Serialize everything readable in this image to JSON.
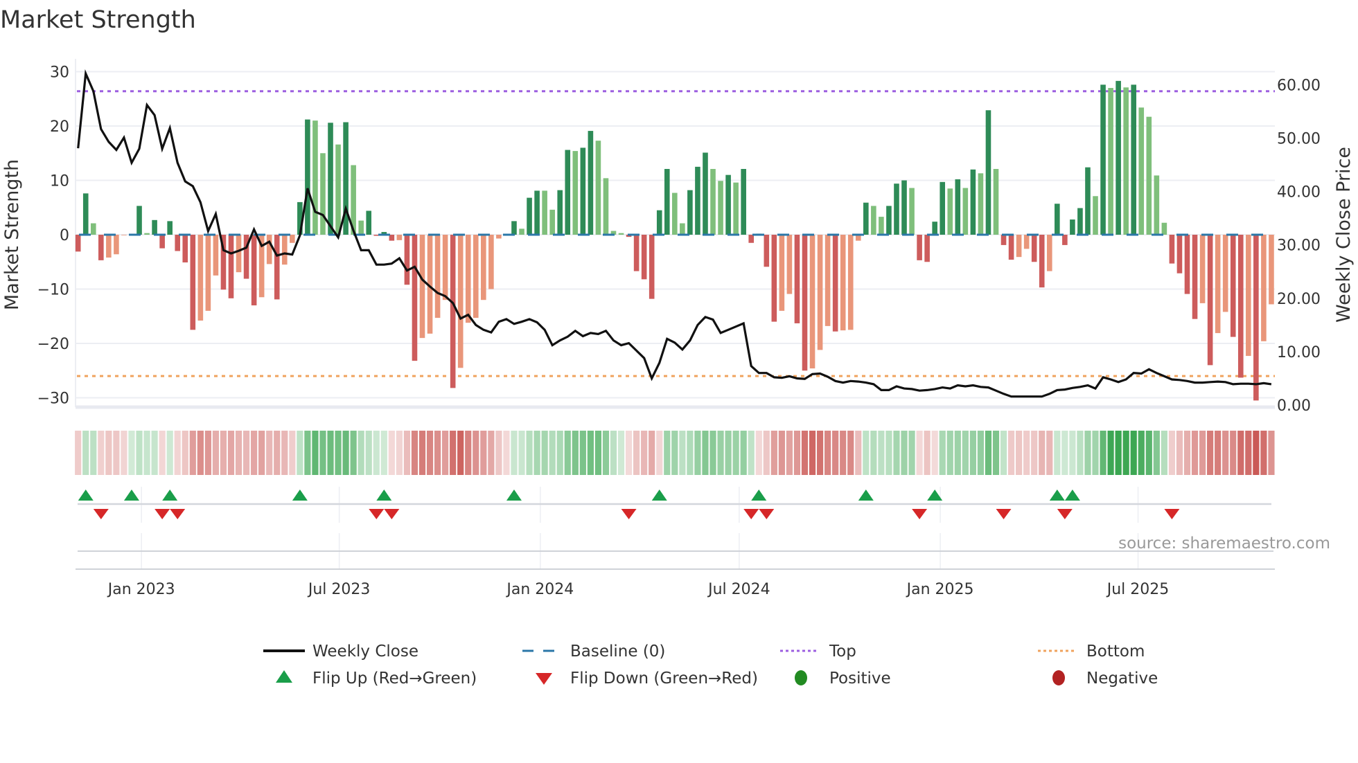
{
  "chart_data": {
    "type": "bar",
    "title": "Market Strength",
    "ylabel": "Market Strength",
    "y2label": "Weekly Close Price",
    "source": "source: sharemaestro.com",
    "start_date": "2022-11-04",
    "interval_days": 7,
    "ylim": [
      -31.5,
      32
    ],
    "y2lim": [
      -0.5,
      62.8
    ],
    "yticks": [
      {
        "v": 30,
        "label": "30"
      },
      {
        "v": 20,
        "label": "20"
      },
      {
        "v": 10,
        "label": "10"
      },
      {
        "v": 0,
        "label": "0"
      },
      {
        "v": -10,
        "label": "−10"
      },
      {
        "v": -20,
        "label": "−20"
      },
      {
        "v": -30,
        "label": "−30"
      }
    ],
    "y2ticks": [
      {
        "v": 60,
        "label": "60.00"
      },
      {
        "v": 50,
        "label": "50.00"
      },
      {
        "v": 40,
        "label": "40.00"
      },
      {
        "v": 30,
        "label": "30.00"
      },
      {
        "v": 20,
        "label": "20.00"
      },
      {
        "v": 10,
        "label": "10.00"
      },
      {
        "v": 0,
        "label": "0.00"
      }
    ],
    "xticks": [
      {
        "date": "2023-01-01",
        "label": "Jan 2023"
      },
      {
        "date": "2023-07-01",
        "label": "Jul 2023"
      },
      {
        "date": "2024-01-01",
        "label": "Jan 2024"
      },
      {
        "date": "2024-07-01",
        "label": "Jul 2024"
      },
      {
        "date": "2025-01-01",
        "label": "Jan 2025"
      },
      {
        "date": "2025-07-01",
        "label": "Jul 2025"
      }
    ],
    "top_level": 26.4,
    "bottom_level": -26.0,
    "strength": [
      -3.1,
      7.6,
      2.1,
      -4.7,
      -4.2,
      -3.6,
      -0.1,
      0.1,
      5.3,
      0.3,
      2.7,
      -2.5,
      2.5,
      -3.0,
      -5.1,
      -17.5,
      -15.8,
      -14.0,
      -7.5,
      -10.1,
      -11.7,
      -6.9,
      -8.1,
      -13.0,
      -11.5,
      -5.4,
      -11.9,
      -5.5,
      -1.5,
      6.0,
      21.2,
      21.0,
      15.0,
      20.6,
      16.6,
      20.7,
      12.8,
      2.6,
      4.4,
      -0.2,
      0.5,
      -1.1,
      -1.0,
      -9.2,
      -23.2,
      -19.0,
      -18.2,
      -15.3,
      -12.0,
      -28.2,
      -24.5,
      -16.2,
      -15.3,
      -12.0,
      -10.0,
      -0.7,
      -0.05,
      2.5,
      1.1,
      6.8,
      8.1,
      8.1,
      4.6,
      8.2,
      15.6,
      15.4,
      16.0,
      19.1,
      17.3,
      10.4,
      0.7,
      0.3,
      -0.4,
      -6.7,
      -8.2,
      -11.8,
      4.5,
      12.1,
      7.7,
      2.1,
      8.2,
      12.5,
      15.1,
      12.1,
      9.9,
      11.0,
      9.6,
      12.1,
      -1.5,
      0.2,
      -5.9,
      -16.0,
      -14.0,
      -10.9,
      -16.3,
      -25.0,
      -24.6,
      -21.2,
      -16.8,
      -17.8,
      -17.6,
      -17.5,
      -1.1,
      5.9,
      5.3,
      3.3,
      5.3,
      9.4,
      10.0,
      8.6,
      -4.7,
      -5.0,
      2.4,
      9.7,
      8.5,
      10.2,
      8.6,
      12.0,
      11.3,
      22.9,
      12.1,
      -1.9,
      -4.6,
      -4.1,
      -2.6,
      -5.0,
      -9.7,
      -6.7,
      5.7,
      -1.9,
      2.8,
      4.9,
      12.4,
      7.1,
      27.6,
      27.0,
      28.3,
      27.1,
      27.6,
      23.4,
      21.7,
      10.9,
      2.2,
      -5.3,
      -7.1,
      -10.9,
      -15.5,
      -12.6,
      -24.0,
      -18.1,
      -14.2,
      -18.8,
      -26.3,
      -22.3,
      -30.5,
      -19.6,
      -12.8
    ],
    "weekly_close": [
      48.1,
      62.1,
      58.8,
      51.7,
      49.3,
      47.8,
      50.1,
      45.4,
      48.0,
      56.2,
      54.3,
      48.0,
      51.9,
      45.4,
      41.9,
      41.0,
      38.0,
      32.6,
      35.8,
      29.0,
      28.4,
      28.9,
      29.5,
      32.9,
      29.8,
      30.6,
      28.0,
      28.4,
      28.2,
      31.8,
      40.6,
      36.2,
      35.6,
      33.5,
      31.4,
      36.8,
      32.7,
      29.0,
      29.0,
      26.3,
      26.3,
      26.5,
      27.5,
      25.2,
      25.9,
      23.5,
      22.2,
      21.0,
      20.4,
      19.1,
      16.2,
      16.9,
      15.0,
      14.1,
      13.6,
      15.6,
      16.1,
      15.2,
      15.6,
      16.1,
      15.5,
      14.1,
      11.2,
      12.1,
      12.8,
      13.9,
      12.9,
      13.5,
      13.3,
      13.9,
      12.1,
      11.2,
      11.6,
      10.2,
      8.8,
      5.0,
      7.9,
      12.4,
      11.7,
      10.4,
      12.1,
      15.0,
      16.5,
      16.0,
      13.5,
      14.1,
      14.7,
      15.3,
      7.3,
      6.0,
      6.0,
      5.2,
      5.1,
      5.4,
      5.0,
      4.9,
      5.8,
      5.9,
      5.3,
      4.5,
      4.2,
      4.5,
      4.4,
      4.2,
      3.9,
      2.8,
      2.8,
      3.5,
      3.1,
      3.0,
      2.7,
      2.8,
      3.0,
      3.3,
      3.1,
      3.7,
      3.5,
      3.7,
      3.4,
      3.3,
      2.7,
      2.1,
      1.6,
      1.6,
      1.6,
      1.6,
      1.6,
      2.1,
      2.8,
      2.9,
      3.2,
      3.4,
      3.7,
      3.1,
      5.2,
      4.8,
      4.3,
      4.8,
      6.0,
      5.9,
      6.7,
      6.0,
      5.4,
      4.8,
      4.7,
      4.5,
      4.2,
      4.2,
      4.3,
      4.4,
      4.3,
      3.9,
      4.0,
      4.0,
      3.9,
      4.1,
      3.9
    ],
    "flip_up_weeks": [
      1,
      7,
      12,
      29,
      40,
      57,
      76,
      89,
      103,
      112,
      128,
      130
    ],
    "flip_down_weeks": [
      3,
      11,
      13,
      39,
      41,
      72,
      88,
      90,
      110,
      121,
      129,
      143
    ],
    "colors": {
      "pos_strong": "#2e8b57",
      "pos_weak": "#7fbf7b",
      "neg_strong": "#cd5c5c",
      "neg_weak": "#e9967a",
      "baseline": "#2b77a8",
      "top": "#9d5fe0",
      "bottom": "#f0a35e",
      "close": "#111111",
      "flip_up": "#1a9e4a",
      "flip_down": "#d62728",
      "positive": "#228b22",
      "negative": "#b22222"
    },
    "legend": {
      "weekly_close": "Weekly Close",
      "baseline": "Baseline (0)",
      "top": "Top",
      "bottom": "Bottom",
      "flip_up": "Flip Up (Red→Green)",
      "flip_down": "Flip Down (Green→Red)",
      "positive": "Positive",
      "negative": "Negative"
    }
  }
}
